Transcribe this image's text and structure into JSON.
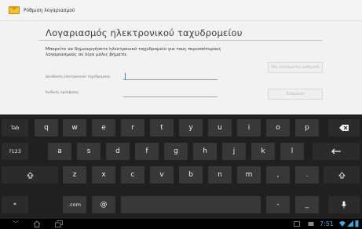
{
  "window": {
    "title": "Ρύθμιση λογαριασμού"
  },
  "content": {
    "heading": "Λογαριασμός ηλεκτρονικού ταχυδρομείου",
    "description": "Μπορείτε να δημιουργήσετε ηλεκτρονικό ταχυδρομείο για τους περισσότερους λογαριασμούς σε λίγα μόλις βήματα.",
    "email_label": "Διεύθυνση ηλεκτρονικού ταχυδρομείου",
    "email_value": "",
    "password_label": "Κωδικός πρόσβασης",
    "password_value": "",
    "manual_setup_label": "Μη αυτόματη ρύθμιση",
    "next_label": "Επόμενο"
  },
  "keyboard": {
    "row1": [
      "Tab",
      "q",
      "w",
      "e",
      "r",
      "t",
      "y",
      "u",
      "i",
      "o",
      "p"
    ],
    "row2": [
      "?123",
      "a",
      "s",
      "d",
      "f",
      "g",
      "h",
      "j",
      "k",
      "l"
    ],
    "row3": [
      "z",
      "x",
      "c",
      "v",
      "b",
      "n",
      "m",
      ",",
      "."
    ],
    "com_key": ".com",
    "at_key": "@",
    "dash_key": "-",
    "underscore_key": "_",
    "settings_key": "⌗"
  },
  "navbar": {
    "clock": "7:51"
  },
  "colors": {
    "accent": "#3ea7dd",
    "keyboard_bg": "#202020",
    "key_bg": "#383838"
  }
}
